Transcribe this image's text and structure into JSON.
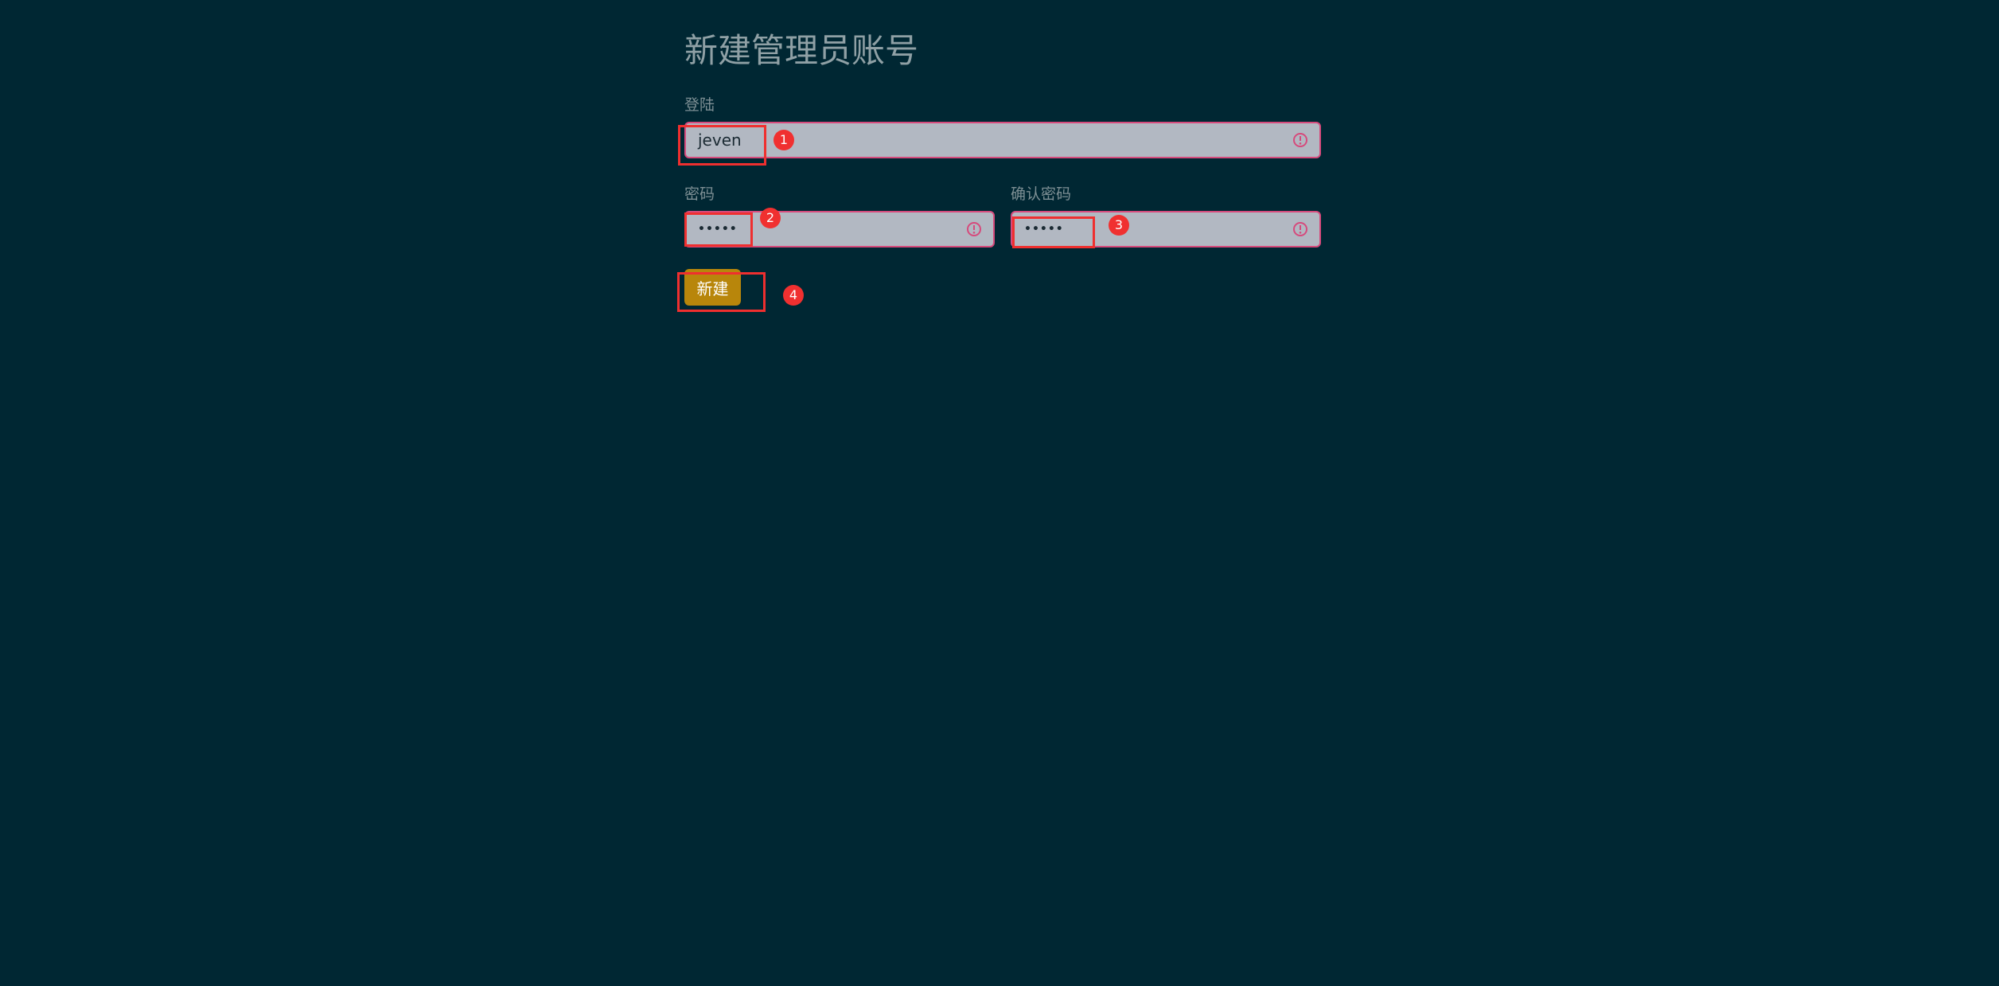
{
  "page": {
    "title": "新建管理员账号"
  },
  "form": {
    "login": {
      "label": "登陆",
      "value": "jeven"
    },
    "password": {
      "label": "密码",
      "value": "•••••"
    },
    "confirm_password": {
      "label": "确认密码",
      "value": "•••••"
    },
    "submit_label": "新建"
  },
  "annotations": [
    "1",
    "2",
    "3",
    "4"
  ],
  "icons": {
    "field_status": "exclamation-circle-icon"
  },
  "colors": {
    "background": "#002733",
    "field_background": "#b2b8c2",
    "field_border_invalid": "#d64a7c",
    "button": "#b8860b",
    "annotation": "#f03030"
  }
}
